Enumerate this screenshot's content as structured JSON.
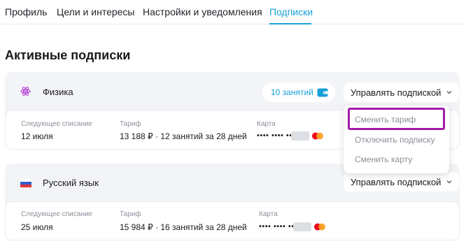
{
  "tabs": [
    {
      "label": "Профиль"
    },
    {
      "label": "Цели и интересы"
    },
    {
      "label": "Настройки и уведомления"
    },
    {
      "label": "Подписки"
    }
  ],
  "active_tab": "Подписки",
  "section_title": "Активные подписки",
  "subscriptions": [
    {
      "subject": "Физика",
      "icon": "atom-icon",
      "lessons_badge": "10 занятий",
      "manage_label": "Управлять подпиской",
      "next_charge_label": "Следующее списание",
      "next_charge_value": "12 июля",
      "tariff_label": "Тариф",
      "tariff_value": "13 188 ₽ · 12 занятий за 28 дней",
      "card_label": "Карта",
      "card_mask": "•••• •••• ••••"
    },
    {
      "subject": "Русский язык",
      "icon": "russian-flag-icon",
      "manage_label": "Управлять подпиской",
      "next_charge_label": "Следующее списание",
      "next_charge_value": "25 июля",
      "tariff_label": "Тариф",
      "tariff_value": "15 984 ₽ · 16 занятий за 28 дней",
      "card_label": "Карта",
      "card_mask": "•••• •••• ••••"
    }
  ],
  "manage_menu": {
    "items": [
      "Сменить тариф",
      "Отключить подписку",
      "Сменить карту"
    ],
    "highlighted": "Сменить тариф"
  },
  "colors": {
    "accent": "#1aa0d9",
    "highlight": "#a21ba7",
    "card_bg": "#f2f4f7",
    "muted_text": "#8a9099"
  }
}
